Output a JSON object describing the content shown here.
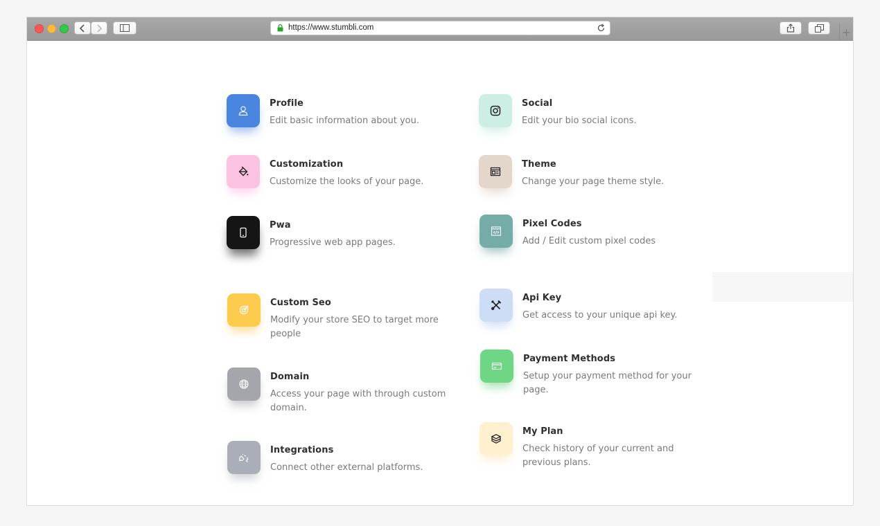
{
  "browser": {
    "url": "https://www.stumbli.com",
    "new_tab_label": "+"
  },
  "settings": {
    "items": [
      {
        "title": "Profile",
        "description": "Edit basic information about you.",
        "icon": "user-icon",
        "color": "#4a86e0"
      },
      {
        "title": "Social",
        "description": "Edit your bio social icons.",
        "icon": "instagram-icon",
        "color": "#cdeee4"
      },
      {
        "title": "Customization",
        "description": "Customize the looks of your page.",
        "icon": "paint-bucket-icon",
        "color": "#fcc2e2"
      },
      {
        "title": "Theme",
        "description": "Change your page theme style.",
        "icon": "layout-icon",
        "color": "#e3d7cb"
      },
      {
        "title": "Pwa",
        "description": "Progressive web app pages.",
        "icon": "mobile-icon",
        "color": "#151515"
      },
      {
        "title": "Pixel Codes",
        "description": "Add / Edit custom pixel codes",
        "icon": "code-window-icon",
        "color": "#76aca8"
      },
      {
        "title": "Custom Seo",
        "description": "Modify your store SEO to target more people",
        "icon": "target-icon",
        "color": "#fdcb4d"
      },
      {
        "title": "Api Key",
        "description": "Get access to your unique api key.",
        "icon": "tools-icon",
        "color": "#cdddf6"
      },
      {
        "title": "Domain",
        "description": "Access your page with through custom domain.",
        "icon": "globe-icon",
        "color": "#a4a6ab"
      },
      {
        "title": "Payment Methods",
        "description": "Setup your payment method for your page.",
        "icon": "credit-card-icon",
        "color": "#6fd686"
      },
      {
        "title": "Integrations",
        "description": "Connect other external platforms.",
        "icon": "plug-icon",
        "color": "#a9aeb8"
      },
      {
        "title": "My Plan",
        "description": "Check history of your current and previous plans.",
        "icon": "box-icon",
        "color": "#fff0d0"
      }
    ]
  }
}
